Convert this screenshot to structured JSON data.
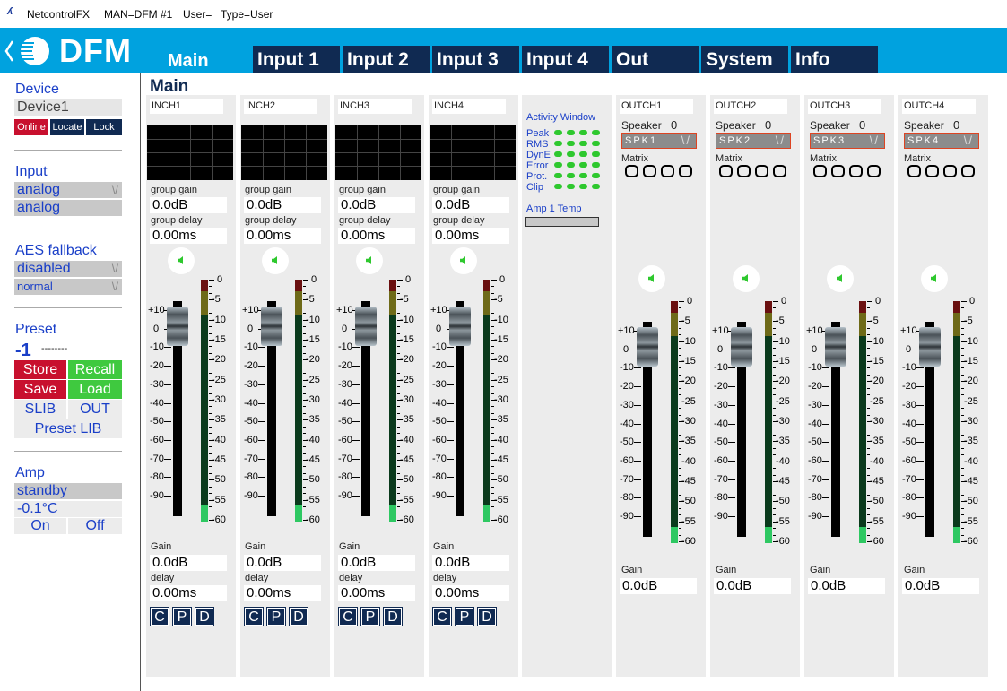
{
  "titlebar": {
    "app": "NetcontrolFX",
    "man": "MAN=DFM #1",
    "user": "User=",
    "type": "Type=User"
  },
  "logo": {
    "text": "DFM"
  },
  "tabs": [
    {
      "label": "Main"
    },
    {
      "label": "Input 1"
    },
    {
      "label": "Input 2"
    },
    {
      "label": "Input 3"
    },
    {
      "label": "Input 4"
    },
    {
      "label": "Out"
    },
    {
      "label": "System"
    },
    {
      "label": "Info"
    }
  ],
  "page_title": "Main",
  "sidebar": {
    "device_title": "Device",
    "device_name": "Device1",
    "online": "Online",
    "locate": "Locate",
    "lock": "Lock",
    "input_title": "Input",
    "input_select": "analog",
    "input_value": "analog",
    "aes_title": "AES fallback",
    "aes_select": "disabled",
    "aes_mode": "normal",
    "preset_title": "Preset",
    "preset_num": "-1",
    "preset_name": "--------",
    "store": "Store",
    "recall": "Recall",
    "save": "Save",
    "load": "Load",
    "slib": "SLIB",
    "out": "OUT",
    "preset_lib": "Preset LIB",
    "amp_title": "Amp",
    "amp_state": "standby",
    "amp_temp": "-0.1°C",
    "on": "On",
    "off": "Off",
    "dropdown_arrow": "\\/"
  },
  "inputs": [
    {
      "name": "INCH1",
      "group_gain_label": "group gain",
      "group_gain": "0.0dB",
      "group_delay_label": "group delay",
      "group_delay": "0.00ms",
      "gain_label": "Gain",
      "gain": "0.0dB",
      "delay_label": "delay",
      "delay": "0.00ms"
    },
    {
      "name": "INCH2",
      "group_gain_label": "group gain",
      "group_gain": "0.0dB",
      "group_delay_label": "group delay",
      "group_delay": "0.00ms",
      "gain_label": "Gain",
      "gain": "0.0dB",
      "delay_label": "delay",
      "delay": "0.00ms"
    },
    {
      "name": "INCH3",
      "group_gain_label": "group gain",
      "group_gain": "0.0dB",
      "group_delay_label": "group delay",
      "group_delay": "0.00ms",
      "gain_label": "Gain",
      "gain": "0.0dB",
      "delay_label": "delay",
      "delay": "0.00ms"
    },
    {
      "name": "INCH4",
      "group_gain_label": "group gain",
      "group_gain": "0.0dB",
      "group_delay_label": "group delay",
      "group_delay": "0.00ms",
      "gain_label": "Gain",
      "gain": "0.0dB",
      "delay_label": "delay",
      "delay": "0.00ms"
    }
  ],
  "cpd_labels": [
    "C",
    "P",
    "D"
  ],
  "activity": {
    "title": "Activity Window",
    "rows": [
      "Peak",
      "RMS",
      "DynE",
      "Error",
      "Prot.",
      "Clip"
    ],
    "amp_temp_label": "Amp 1 Temp"
  },
  "outputs": [
    {
      "name": "OUTCH1",
      "speaker_label": "Speaker",
      "speaker_num": "0",
      "spk": "SPK1",
      "matrix_label": "Matrix",
      "gain_label": "Gain",
      "gain": "0.0dB"
    },
    {
      "name": "OUTCH2",
      "speaker_label": "Speaker",
      "speaker_num": "0",
      "spk": "SPK2",
      "matrix_label": "Matrix",
      "gain_label": "Gain",
      "gain": "0.0dB"
    },
    {
      "name": "OUTCH3",
      "speaker_label": "Speaker",
      "speaker_num": "0",
      "spk": "SPK3",
      "matrix_label": "Matrix",
      "gain_label": "Gain",
      "gain": "0.0dB"
    },
    {
      "name": "OUTCH4",
      "speaker_label": "Speaker",
      "speaker_num": "0",
      "spk": "SPK4",
      "matrix_label": "Matrix",
      "gain_label": "Gain",
      "gain": "0.0dB"
    }
  ],
  "fader_scale": [
    "+10",
    "0",
    "-10",
    "-20",
    "-30",
    "-40",
    "-50",
    "-60",
    "-70",
    "-80",
    "-90"
  ],
  "meter_scale": [
    "0",
    "-5",
    "-10",
    "-15",
    "-20",
    "-25",
    "-30",
    "-35",
    "-40",
    "-45",
    "-50",
    "-55",
    "-60"
  ],
  "colors": {
    "accent": "#00a2df",
    "tab": "#102a52",
    "red": "#c8102e",
    "green": "#3fc93f",
    "led": "#2ec82e"
  }
}
